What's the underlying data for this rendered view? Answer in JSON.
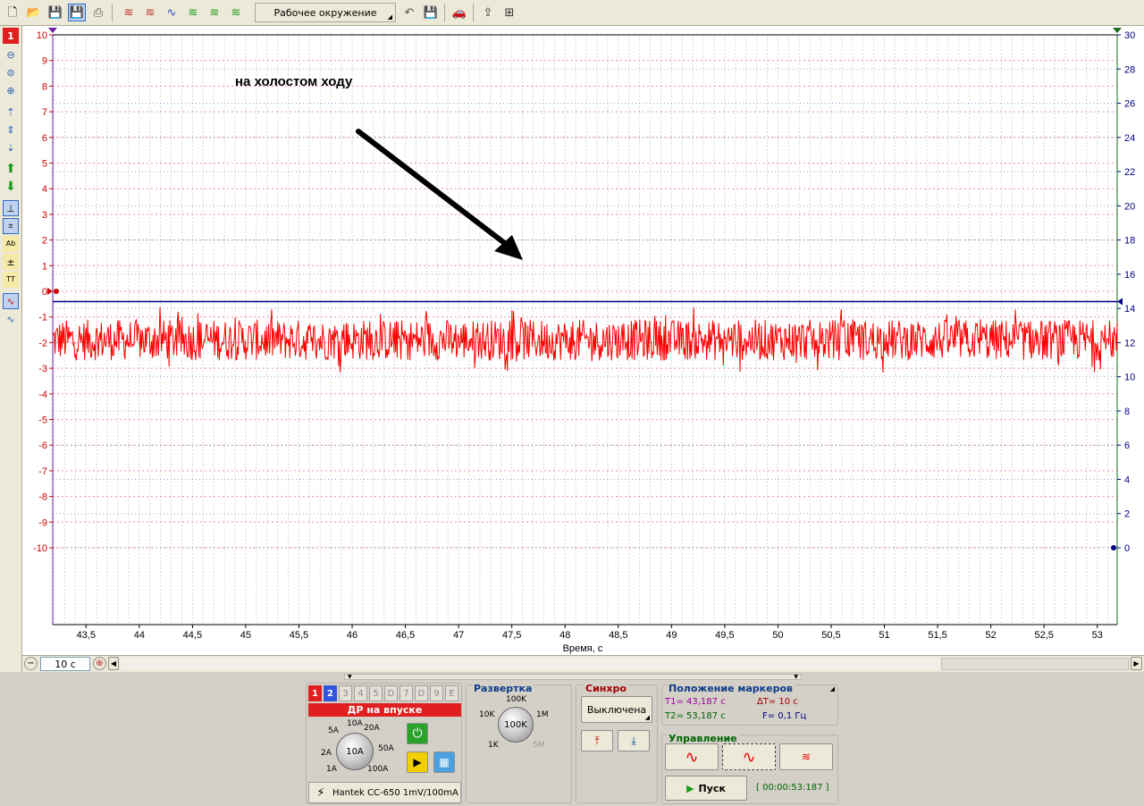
{
  "toolbar": {
    "workspace_label": "Рабочее окружение"
  },
  "left_toolbar": {
    "channel_badge": "1"
  },
  "chart_data": {
    "type": "line",
    "annotation": "на холостом ходу",
    "xlabel": "Время, с",
    "x_ticks": [
      "43,5",
      "44",
      "44,5",
      "45",
      "45,5",
      "46",
      "46,5",
      "47",
      "47,5",
      "48",
      "48,5",
      "49",
      "49,5",
      "50",
      "50,5",
      "51",
      "51,5",
      "52",
      "52,5",
      "53"
    ],
    "xlim": [
      43.187,
      53.187
    ],
    "left_ticks": [
      "10",
      "9",
      "8",
      "7",
      "6",
      "5",
      "4",
      "3",
      "2",
      "1",
      "0",
      "-1",
      "-2",
      "-3",
      "-4",
      "-5",
      "-6",
      "-7",
      "-8",
      "-9",
      "-10"
    ],
    "ylim_left": [
      -10,
      10
    ],
    "right_ticks": [
      "30",
      "28",
      "26",
      "24",
      "22",
      "20",
      "18",
      "16",
      "14",
      "12",
      "10",
      "8",
      "6",
      "4",
      "2",
      "0"
    ],
    "ylim_right": [
      0,
      30
    ],
    "grid": true,
    "series": [
      {
        "channel": "1",
        "color": "#ff0000",
        "level": -1.9,
        "min": -3.2,
        "max": -0.05
      },
      {
        "channel": "2",
        "color": "#00008b",
        "level": 14.4
      }
    ],
    "colors": {
      "channel1": "#ff0000",
      "channel2": "#00008b",
      "left_axis": "#cc0000",
      "right_axis": "#000080"
    }
  },
  "scroll": {
    "zoom_value": "10 с"
  },
  "channels": {
    "tabs": [
      "1",
      "2",
      "3",
      "4",
      "5",
      "D",
      "7",
      "D",
      "9",
      "E"
    ],
    "title": "ДР на впуске",
    "knob_value": "10A",
    "range_labels": [
      "10A",
      "20A",
      "50A",
      "100A",
      "5A",
      "2A",
      "1A"
    ],
    "probe": "Hantek CC-650 1mV/100mA"
  },
  "sweep": {
    "title": "Развертка",
    "knob_value": "100K",
    "labels": [
      "100K",
      "1M",
      "5M",
      "1K",
      "10K"
    ]
  },
  "sync": {
    "title": "Синхро",
    "state": "Выключена"
  },
  "markers": {
    "title": "Положение маркеров",
    "t1": "T1= 43,187 с",
    "t2": "T2= 53,187 с",
    "dt": "∆T= 10 с",
    "f": "F= 0,1 Гц"
  },
  "control": {
    "title": "Управление",
    "start_label": "Пуск",
    "timer": "[ 00:00:53:187 ]"
  }
}
